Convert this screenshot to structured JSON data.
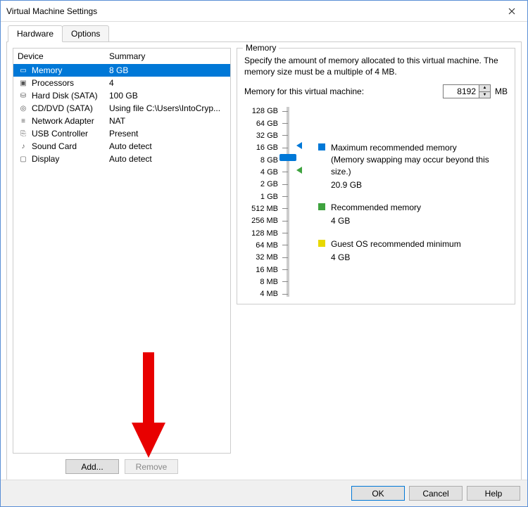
{
  "window": {
    "title": "Virtual Machine Settings"
  },
  "tabs": {
    "hardware": "Hardware",
    "options": "Options",
    "active": "hardware"
  },
  "device_list": {
    "col1": "Device",
    "col2": "Summary",
    "rows": [
      {
        "icon": "memory-icon",
        "name": "Memory",
        "summary": "8 GB",
        "selected": true
      },
      {
        "icon": "cpu-icon",
        "name": "Processors",
        "summary": "4"
      },
      {
        "icon": "disk-icon",
        "name": "Hard Disk (SATA)",
        "summary": "100 GB"
      },
      {
        "icon": "cd-icon",
        "name": "CD/DVD (SATA)",
        "summary": "Using file C:\\Users\\IntoCryp..."
      },
      {
        "icon": "nic-icon",
        "name": "Network Adapter",
        "summary": "NAT"
      },
      {
        "icon": "usb-icon",
        "name": "USB Controller",
        "summary": "Present"
      },
      {
        "icon": "sound-icon",
        "name": "Sound Card",
        "summary": "Auto detect"
      },
      {
        "icon": "display-icon",
        "name": "Display",
        "summary": "Auto detect"
      }
    ]
  },
  "left_buttons": {
    "add": "Add...",
    "remove": "Remove"
  },
  "memory_panel": {
    "legend": "Memory",
    "description": "Specify the amount of memory allocated to this virtual machine. The memory size must be a multiple of 4 MB.",
    "label": "Memory for this virtual machine:",
    "value": "8192",
    "unit": "MB",
    "ticks": [
      "128 GB",
      "64 GB",
      "32 GB",
      "16 GB",
      "8 GB",
      "4 GB",
      "2 GB",
      "1 GB",
      "512 MB",
      "256 MB",
      "128 MB",
      "64 MB",
      "32 MB",
      "16 MB",
      "8 MB",
      "4 MB"
    ],
    "legends": {
      "max": {
        "label": "Maximum recommended memory",
        "note": "(Memory swapping may occur beyond this size.)",
        "value": "20.9 GB"
      },
      "rec": {
        "label": "Recommended memory",
        "value": "4 GB"
      },
      "min": {
        "label": "Guest OS recommended minimum",
        "value": "4 GB"
      }
    }
  },
  "bottom": {
    "ok": "OK",
    "cancel": "Cancel",
    "help": "Help"
  }
}
